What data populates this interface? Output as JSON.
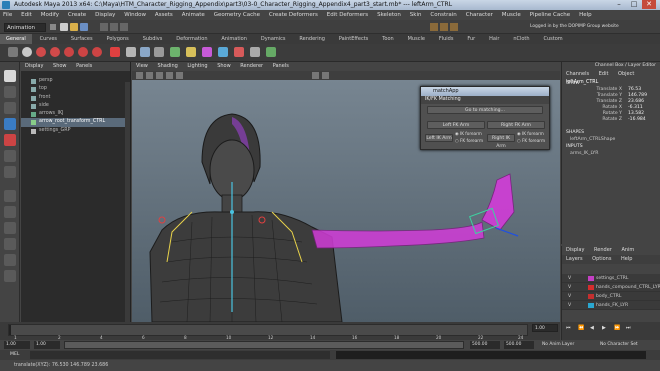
{
  "window": {
    "title": "Autodesk Maya 2013 x64: C:\\Maya\\HTM_Character_Rigging_Appendix\\part3\\03-0_Character_Rigging_Appendix4_part3_start.mb* --- leftArm_CTRL",
    "min": "–",
    "max": "□",
    "close": "✕"
  },
  "menubar": [
    "File",
    "Edit",
    "Modify",
    "Create",
    "Display",
    "Window",
    "Assets",
    "Animate",
    "Geometry Cache",
    "Create Deformers",
    "Edit Deformers",
    "Skeleton",
    "Skin",
    "Constrain",
    "Character",
    "Muscle",
    "Pipeline Cache",
    "Help"
  ],
  "statusline": {
    "mode": "Animation",
    "login": "Logged in by the DOPIMP Group website"
  },
  "shelf_tabs": [
    "General",
    "Curves",
    "Surfaces",
    "Polygons",
    "Subdivs",
    "Deformation",
    "Animation",
    "Dynamics",
    "Rendering",
    "PaintEffects",
    "Toon",
    "Muscle",
    "Fluids",
    "Fur",
    "Hair",
    "nCloth",
    "Custom"
  ],
  "shelf_active": "General",
  "outliner": {
    "menu": [
      "Display",
      "Show",
      "Panels"
    ],
    "items": [
      "persp",
      "top",
      "front",
      "side",
      "arrows_IKJ",
      "arrow_root_transform_CTRL",
      "settings_GRP"
    ],
    "selected": "arrow_root_transform_CTRL"
  },
  "viewport": {
    "menu": [
      "View",
      "Shading",
      "Lighting",
      "Show",
      "Renderer",
      "Panels"
    ],
    "arm_color": "#d23cd8",
    "body_color": "#2e2e2e"
  },
  "dialog": {
    "title": "matchApp",
    "section": "IK/FK Matching",
    "go": "Go to matching...",
    "left_fk": "Left FK Arm",
    "right_fk": "Right FK Arm",
    "left_ik": "Left IK Arm",
    "right_ik": "Right IK Arm",
    "ik_forearm": "IK forearm",
    "fk_forearm": "FK forearm"
  },
  "channel_box": {
    "header": [
      "Channel Box / Layer Editor"
    ],
    "tabs": [
      "Channels",
      "Edit",
      "Object",
      "Show"
    ],
    "object": "leftArm_CTRL",
    "channels": [
      {
        "name": "Translate X",
        "value": "76.53"
      },
      {
        "name": "Translate Y",
        "value": "146.789"
      },
      {
        "name": "Translate Z",
        "value": "23.686"
      },
      {
        "name": "Rotate X",
        "value": "-6.311"
      },
      {
        "name": "Rotate Y",
        "value": "13.582"
      },
      {
        "name": "Rotate Z",
        "value": "-16.984"
      }
    ],
    "shapes_label": "SHAPES",
    "shape": "leftArm_CTRLShape",
    "inputs_label": "INPUTS",
    "input": "arms_IK_LYR"
  },
  "layer_editor": {
    "tabs": [
      "Display",
      "Render",
      "Anim"
    ],
    "menu": [
      "Layers",
      "Options",
      "Help"
    ],
    "layers": [
      {
        "v": "V",
        "name": "settings_CTRL",
        "color": "#c43fc4"
      },
      {
        "v": "V",
        "name": "hands_compound_CTRL_LYR",
        "color": "#d52d2d"
      },
      {
        "v": "V",
        "name": "body_CTRL",
        "color": "#c42f2f"
      },
      {
        "v": "V",
        "name": "hands_FK_LYR",
        "color": "#2aa7d0"
      }
    ]
  },
  "time": {
    "ticks": [
      "1",
      "2",
      "4",
      "6",
      "8",
      "10",
      "12",
      "14",
      "16",
      "18",
      "20",
      "22",
      "24"
    ],
    "current": "1.00",
    "start": "1.00",
    "start2": "1.00",
    "end": "500.00",
    "end2": "500.00",
    "anim_layer": "No Anim Layer",
    "char_set": "No Character Set"
  },
  "cmd": {
    "label": "MEL"
  },
  "help": {
    "text": "translate(XYZ):   76.530     146.789     23.686"
  }
}
